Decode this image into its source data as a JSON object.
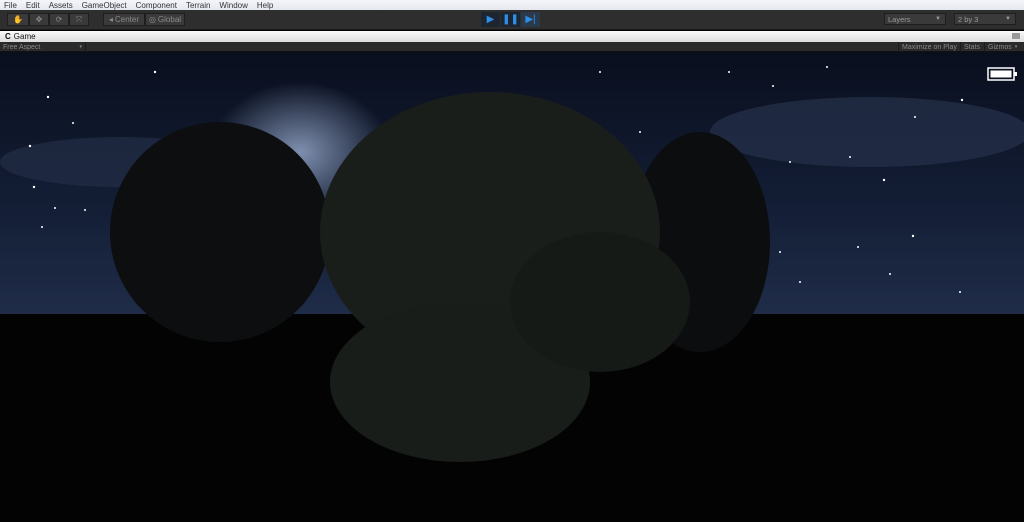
{
  "menu": [
    "File",
    "Edit",
    "Assets",
    "GameObject",
    "Component",
    "Terrain",
    "Window",
    "Help"
  ],
  "toolbar": {
    "pivot": "Center",
    "space": "Global",
    "layers": "Layers",
    "layout": "2 by 3"
  },
  "tab": {
    "title": "Game"
  },
  "gamebar": {
    "aspect": "Free Aspect",
    "maximize": "Maximize on Play",
    "stats": "Stats",
    "gizmos": "Gizmos"
  }
}
